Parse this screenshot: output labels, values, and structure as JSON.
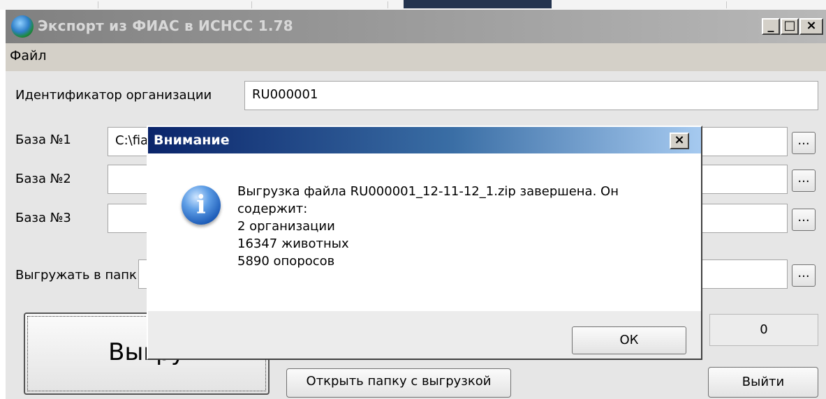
{
  "window": {
    "title": "Экспорт из ФИАС в ИСНСС 1.78",
    "controls": {
      "minimize": "_",
      "maximize": "□",
      "close": "×"
    }
  },
  "menu": {
    "file": "Файл"
  },
  "form": {
    "org_id_label": "Идентификатор организации",
    "org_id_value": "RU000001",
    "db1_label": "База №1",
    "db1_value": "C:\\fia",
    "db2_label": "База №2",
    "db2_value": "",
    "db3_label": "База №3",
    "db3_value": "",
    "export_folder_label": "Выгружать в папк",
    "browse_label": "..."
  },
  "buttons": {
    "export_label": "Выгру",
    "open_folder_label": "Открыть папку с выгрузкой",
    "exit_label": "Выйти"
  },
  "counter_value": "0",
  "dialog": {
    "title": "Внимание",
    "close": "×",
    "icon": "info-icon",
    "message_lines": [
      "Выгрузка файла RU000001_12-11-12_1.zip завершена. Он",
      "содержит:",
      "2 организации",
      "16347 животных",
      "5890 опоросов"
    ],
    "ok_label": "ОК"
  },
  "colors": {
    "dialog_title_start": "#0a246a",
    "dialog_title_end": "#a6caf0",
    "window_title_inactive": "#808080"
  }
}
